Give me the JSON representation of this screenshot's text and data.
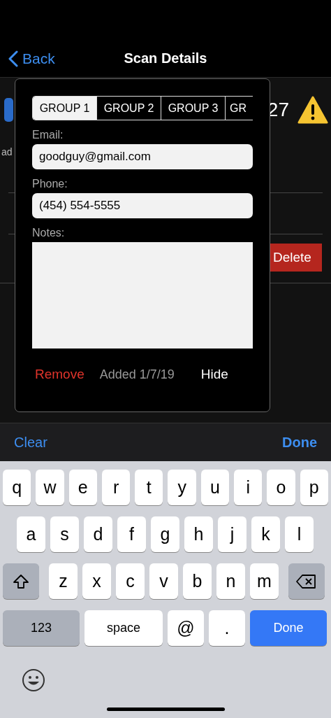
{
  "nav_bar": {
    "back_label": "Back",
    "title": "Scan Details"
  },
  "background": {
    "count": "27",
    "address_label": "ad",
    "delete_label": "Delete"
  },
  "popup": {
    "groups": [
      {
        "label": "GROUP 1",
        "selected": true
      },
      {
        "label": "GROUP 2",
        "selected": false
      },
      {
        "label": "GROUP 3",
        "selected": false
      },
      {
        "label": "GR",
        "selected": false
      }
    ],
    "email_label": "Email:",
    "email": "goodguy@gmail.com",
    "phone_label": "Phone:",
    "phone": "(454) 554-5555",
    "notes_label": "Notes:",
    "remove_label": "Remove",
    "added": "Added 1/7/19",
    "hide_label": "Hide"
  },
  "toolbar": {
    "clear": "Clear",
    "done": "Done"
  },
  "keyboard": {
    "key_rows": [
      {
        "keys": [
          {
            "kind": "letter",
            "label": "q"
          },
          {
            "kind": "letter",
            "label": "w"
          },
          {
            "kind": "letter",
            "label": "e"
          },
          {
            "kind": "letter",
            "label": "r"
          },
          {
            "kind": "letter",
            "label": "t"
          },
          {
            "kind": "letter",
            "label": "y"
          },
          {
            "kind": "letter",
            "label": "u"
          },
          {
            "kind": "letter",
            "label": "i"
          },
          {
            "kind": "letter",
            "label": "o"
          },
          {
            "kind": "letter",
            "label": "p"
          }
        ]
      },
      {
        "keys": [
          {
            "kind": "letter",
            "label": "a"
          },
          {
            "kind": "letter",
            "label": "s"
          },
          {
            "kind": "letter",
            "label": "d"
          },
          {
            "kind": "letter",
            "label": "f"
          },
          {
            "kind": "letter",
            "label": "g"
          },
          {
            "kind": "letter",
            "label": "h"
          },
          {
            "kind": "letter",
            "label": "j"
          },
          {
            "kind": "letter",
            "label": "k"
          },
          {
            "kind": "letter",
            "label": "l"
          }
        ]
      },
      {
        "keys": [
          {
            "kind": "shift"
          },
          {
            "kind": "letter",
            "label": "z"
          },
          {
            "kind": "letter",
            "label": "x"
          },
          {
            "kind": "letter",
            "label": "c"
          },
          {
            "kind": "letter",
            "label": "v"
          },
          {
            "kind": "letter",
            "label": "b"
          },
          {
            "kind": "letter",
            "label": "n"
          },
          {
            "kind": "letter",
            "label": "m"
          },
          {
            "kind": "delete"
          }
        ]
      },
      {
        "keys": [
          {
            "kind": "mode",
            "label": "123"
          },
          {
            "kind": "space",
            "label": "space"
          },
          {
            "kind": "symbol",
            "label": "@"
          },
          {
            "kind": "symbol",
            "label": "."
          },
          {
            "kind": "action",
            "label": "Done"
          }
        ]
      }
    ]
  }
}
